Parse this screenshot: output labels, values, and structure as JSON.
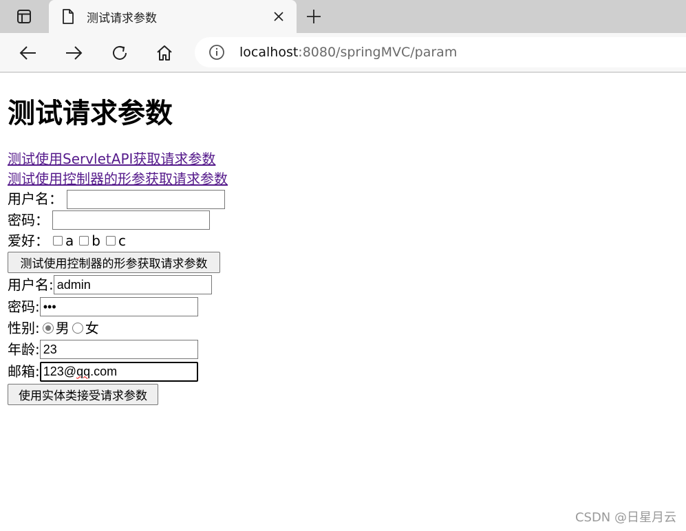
{
  "browser": {
    "tab_title": "测试请求参数",
    "url_host": "localhost",
    "url_rest": ":8080/springMVC/param",
    "icons": {
      "tab_actions": "tab-actions-icon",
      "page": "page-icon",
      "close": "close-icon",
      "new_tab": "plus-icon",
      "back": "back-arrow-icon",
      "forward": "forward-arrow-icon",
      "refresh": "refresh-icon",
      "home": "home-icon",
      "info": "info-icon"
    }
  },
  "page": {
    "heading": "测试请求参数",
    "links": [
      "测试使用ServletAPI获取请求参数",
      "测试使用控制器的形参获取请求参数"
    ],
    "form1": {
      "username_label": "用户名：",
      "username_value": "",
      "password_label": "密码：",
      "password_value": "",
      "hobby_label": "爱好：",
      "hobbies": [
        "a",
        "b",
        "c"
      ],
      "submit": "测试使用控制器的形参获取请求参数"
    },
    "form2": {
      "username_label": "用户名:",
      "username_value": "admin",
      "password_label": "密码:",
      "password_value": "•••",
      "gender_label": "性别:",
      "gender_options": [
        "男",
        "女"
      ],
      "gender_selected": "男",
      "age_label": "年龄:",
      "age_value": "23",
      "email_label": "邮箱:",
      "email_value_a": "123@",
      "email_value_b": "qq",
      "email_value_c": ".com",
      "submit": "使用实体类接受请求参数"
    }
  },
  "watermark": "CSDN @日星月云"
}
